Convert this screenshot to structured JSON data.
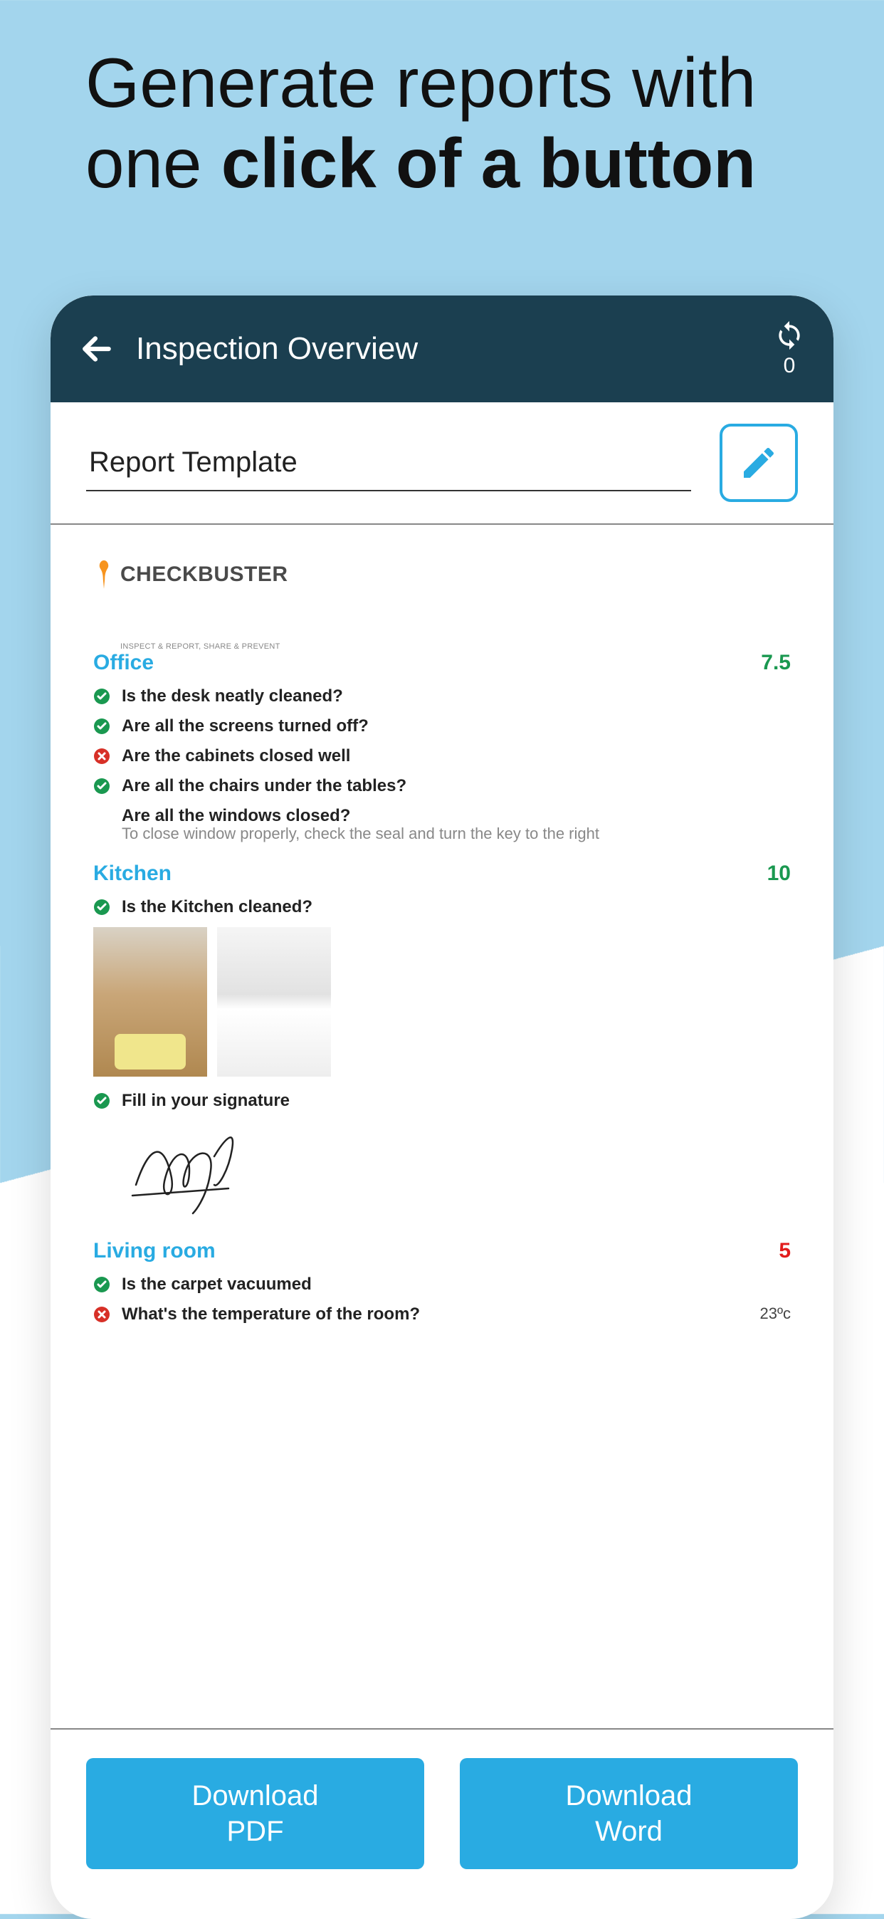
{
  "headline": {
    "line1": "Generate reports with",
    "line2": "one ",
    "bold": "click of a button"
  },
  "appBar": {
    "title": "Inspection Overview",
    "refreshCount": "0"
  },
  "template": {
    "label": "Report Template"
  },
  "brand": {
    "name": "CHECKBUSTER",
    "tagline": "INSPECT & REPORT, SHARE & PREVENT"
  },
  "sections": [
    {
      "title": "Office",
      "score": "7.5",
      "scoreClass": "score-green",
      "items": [
        {
          "status": "ok",
          "text": "Is the desk neatly cleaned?"
        },
        {
          "status": "ok",
          "text": "Are all the screens turned off?"
        },
        {
          "status": "fail",
          "text": "Are the cabinets closed well"
        },
        {
          "status": "ok",
          "text": "Are all the chairs under the tables?"
        },
        {
          "status": "none",
          "text": "Are all the windows closed?",
          "hint": "To close window properly, check the seal and turn the key to the right"
        }
      ]
    },
    {
      "title": "Kitchen",
      "score": "10",
      "scoreClass": "score-green",
      "items": [
        {
          "status": "ok",
          "text": "Is the Kitchen cleaned?",
          "photos": true
        },
        {
          "status": "ok",
          "text": "Fill in your signature",
          "signature": true
        }
      ]
    },
    {
      "title": "Living room",
      "score": "5",
      "scoreClass": "score-red",
      "items": [
        {
          "status": "ok",
          "text": "Is the carpet vacuumed"
        },
        {
          "status": "fail",
          "text": "What's the temperature of the room?",
          "value": "23ºc"
        }
      ]
    }
  ],
  "buttons": {
    "pdf_l1": "Download",
    "pdf_l2": "PDF",
    "word_l1": "Download",
    "word_l2": "Word"
  }
}
